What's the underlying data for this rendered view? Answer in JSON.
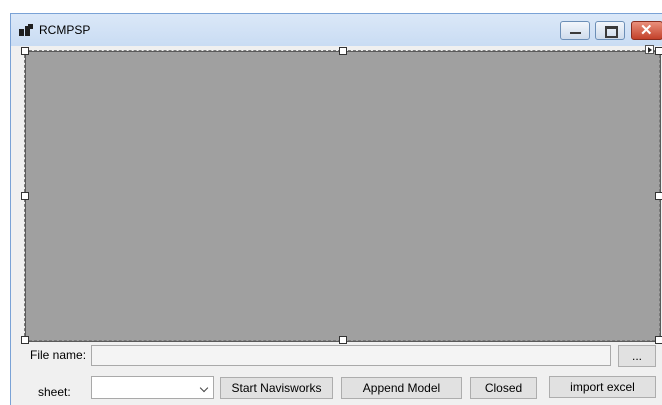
{
  "window": {
    "title": "RCMPSP"
  },
  "title_controls": {
    "minimize_icon": "minimize-icon",
    "maximize_icon": "maximize-icon",
    "close_icon": "close-icon",
    "close_glyph": "✕"
  },
  "form": {
    "file_name_label": "File name:",
    "file_name_value": "",
    "browse_label": "...",
    "sheet_label": "sheet:",
    "sheet_value": ""
  },
  "buttons": {
    "start": "Start Navisworks",
    "append": "Append Model",
    "closed": "Closed",
    "import": "import excel"
  },
  "colors": {
    "canvas": "#a0a0a0",
    "close_button": "#c3412a"
  }
}
